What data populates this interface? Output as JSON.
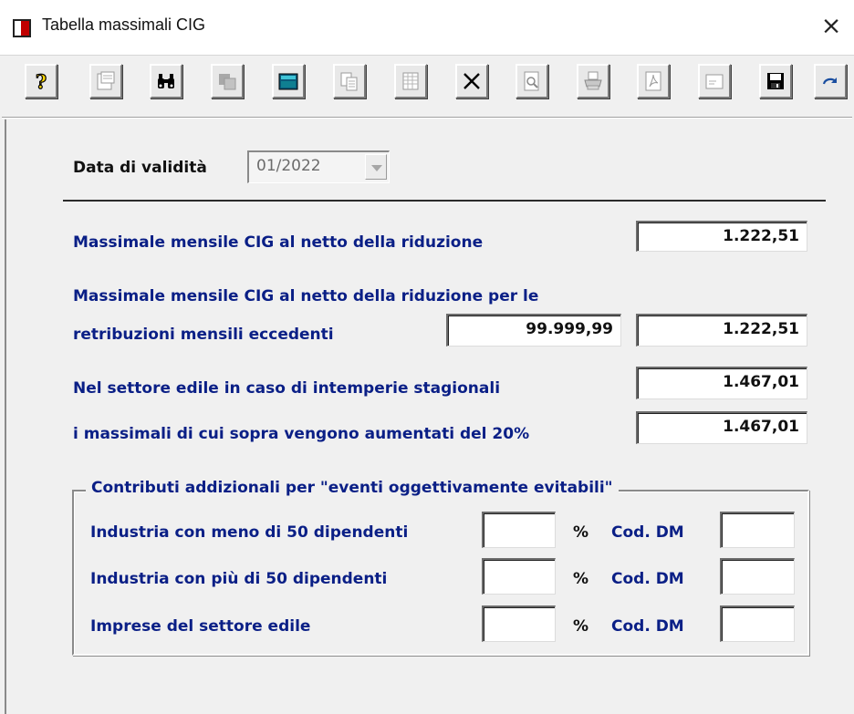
{
  "window": {
    "title": "Tabella massimali CIG",
    "close_label": "×"
  },
  "toolbar": {
    "buttons": [
      {
        "name": "help",
        "icon": "question-icon"
      },
      {
        "name": "properties",
        "icon": "properties-icon"
      },
      {
        "name": "search",
        "icon": "binoculars-icon"
      },
      {
        "name": "duplicate",
        "icon": "duplicate-icon"
      },
      {
        "name": "calculator",
        "icon": "calculator-icon"
      },
      {
        "name": "copy",
        "icon": "copy-icon"
      },
      {
        "name": "grid",
        "icon": "grid-icon"
      },
      {
        "name": "delete",
        "icon": "x-icon"
      },
      {
        "name": "preview",
        "icon": "print-preview-icon"
      },
      {
        "name": "print",
        "icon": "printer-icon"
      },
      {
        "name": "pdf",
        "icon": "pdf-icon"
      },
      {
        "name": "note",
        "icon": "note-icon"
      },
      {
        "name": "save",
        "icon": "floppy-disk-icon"
      },
      {
        "name": "refresh",
        "icon": "redo-icon"
      }
    ]
  },
  "form": {
    "validity_label": "Data di validità",
    "validity_value": "01/2022",
    "monthly_label": "Massimale mensile CIG al netto della riduzione",
    "monthly_value": "1.222,51",
    "excess_label_1": "Massimale mensile CIG al netto della riduzione per le",
    "excess_label_2": "retribuzioni mensili eccedenti",
    "excess_threshold": "99.999,99",
    "excess_value": "1.222,51",
    "building_label": "Nel settore edile in caso di intemperie stagionali",
    "building_value": "1.467,01",
    "increase_label": "i massimali di cui sopra vengono aumentati del 20%",
    "increase_value": "1.467,01"
  },
  "contributions": {
    "title": "Contributi addizionali per \"eventi oggettivamente evitabili\"",
    "percent_symbol": "%",
    "dm_label": "Cod. DM",
    "rows": [
      {
        "label": "Industria con meno di 50 dipendenti",
        "percent": "",
        "dm": ""
      },
      {
        "label": "Industria con più di 50 dipendenti",
        "percent": "",
        "dm": ""
      },
      {
        "label": "Imprese del settore edile",
        "percent": "",
        "dm": ""
      }
    ]
  }
}
